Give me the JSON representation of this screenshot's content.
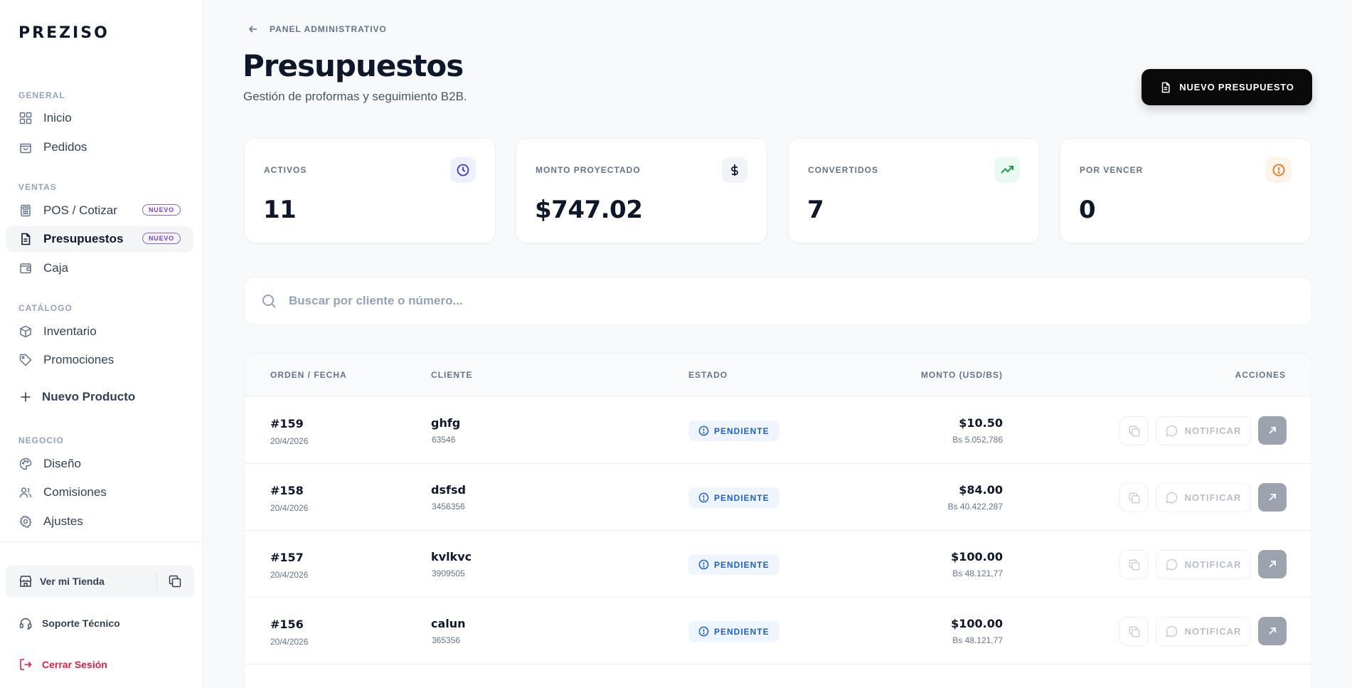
{
  "app": {
    "logo": "PREZISO"
  },
  "sidebar": {
    "sections": {
      "general": "GENERAL",
      "ventas": "VENTAS",
      "catalogo": "CATÁLOGO",
      "negocio": "NEGOCIO"
    },
    "items": {
      "inicio": "Inicio",
      "pedidos": "Pedidos",
      "pos": "POS / Cotizar",
      "presupuestos": "Presupuestos",
      "caja": "Caja",
      "inventario": "Inventario",
      "promociones": "Promociones",
      "diseno": "Diseño",
      "comisiones": "Comisiones",
      "ajustes": "Ajustes"
    },
    "badge_new": "NUEVO",
    "new_product": "Nuevo Producto",
    "store": "Ver mi Tienda",
    "support": "Soporte Técnico",
    "logout": "Cerrar Sesión"
  },
  "header": {
    "breadcrumb": "PANEL ADMINISTRATIVO",
    "title": "Presupuestos",
    "subtitle": "Gestión de proformas y seguimiento B2B.",
    "new_button": "NUEVO PRESUPUESTO"
  },
  "stats": {
    "activos": {
      "label": "ACTIVOS",
      "value": "11"
    },
    "monto": {
      "label": "MONTO PROYECTADO",
      "value": "$747.02"
    },
    "convertidos": {
      "label": "CONVERTIDOS",
      "value": "7"
    },
    "vencer": {
      "label": "POR VENCER",
      "value": "0"
    }
  },
  "search": {
    "placeholder": "Buscar por cliente o número..."
  },
  "table": {
    "headers": {
      "orden": "ORDEN / FECHA",
      "cliente": "CLIENTE",
      "estado": "ESTADO",
      "monto": "MONTO (USD/BS)",
      "acciones": "ACCIONES"
    },
    "notify_label": "NOTIFICAR",
    "rows": [
      {
        "num": "#159",
        "date": "20/4/2026",
        "client": "ghfg",
        "phone": "63546",
        "status": "PENDIENTE",
        "usd": "$10.50",
        "bs": "Bs 5.052,786"
      },
      {
        "num": "#158",
        "date": "20/4/2026",
        "client": "dsfsd",
        "phone": "3456356",
        "status": "PENDIENTE",
        "usd": "$84.00",
        "bs": "Bs 40.422,287"
      },
      {
        "num": "#157",
        "date": "20/4/2026",
        "client": "kvlkvc",
        "phone": "3909505",
        "status": "PENDIENTE",
        "usd": "$100.00",
        "bs": "Bs 48.121,77"
      },
      {
        "num": "#156",
        "date": "20/4/2026",
        "client": "calun",
        "phone": "365356",
        "status": "PENDIENTE",
        "usd": "$100.00",
        "bs": "Bs 48.121,77"
      }
    ]
  },
  "colors": {
    "accent": "#0a0a0a",
    "badge": "#8b5cf6",
    "pending": "#1d5fd6",
    "logout": "#e11d48",
    "converted": "#16a34a",
    "warning": "#f97316",
    "active_icon": "#4338ca"
  }
}
